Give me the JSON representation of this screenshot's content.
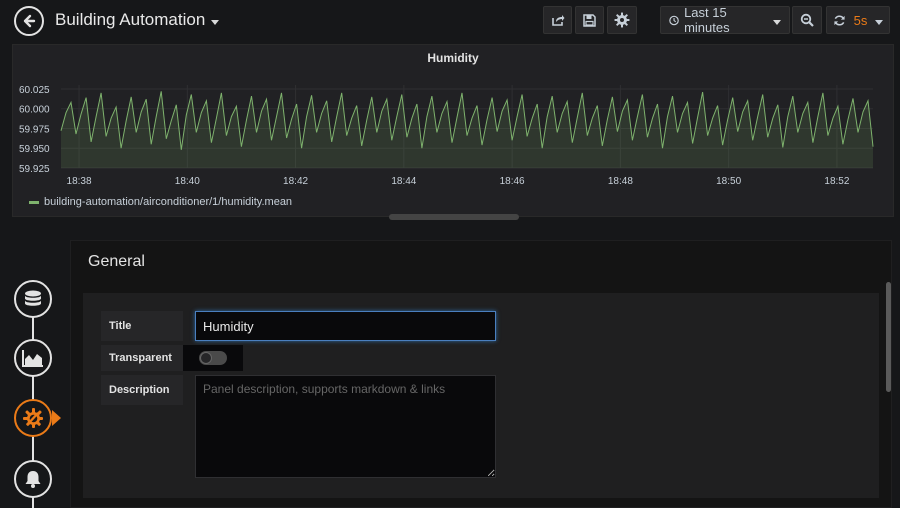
{
  "header": {
    "dashboard_title": "Building Automation",
    "time_range": "Last 15 minutes",
    "refresh_interval": "5s"
  },
  "panel": {
    "title": "Humidity"
  },
  "chart_data": {
    "type": "line",
    "title": "Humidity",
    "xlabel": "",
    "ylabel": "",
    "x_ticks": [
      "18:38",
      "18:40",
      "18:42",
      "18:44",
      "18:46",
      "18:48",
      "18:50",
      "18:52"
    ],
    "y_ticks": [
      "60.025",
      "60.000",
      "59.975",
      "59.950",
      "59.925"
    ],
    "ylim": [
      59.925,
      60.03
    ],
    "xlim": [
      "18:37:40",
      "18:52:40"
    ],
    "grid": true,
    "fill": true,
    "color": "#7eb26d",
    "legend_position": "bottom-left",
    "series": [
      {
        "name": "building-automation/airconditioner/1/humidity.mean",
        "values": [
          59.972,
          59.995,
          60.008,
          59.968,
          59.993,
          60.014,
          59.958,
          59.99,
          60.02,
          59.965,
          59.988,
          60.002,
          59.95,
          59.985,
          60.015,
          59.97,
          59.996,
          60.012,
          59.955,
          59.99,
          60.022,
          59.962,
          59.985,
          60.005,
          59.948,
          59.992,
          60.018,
          59.97,
          59.995,
          60.01,
          59.957,
          59.988,
          60.02,
          59.966,
          59.99,
          60.003,
          59.952,
          59.986,
          60.016,
          59.97,
          59.997,
          60.012,
          59.96,
          59.99,
          60.02,
          59.963,
          59.987,
          60.006,
          59.95,
          59.99,
          60.017,
          59.97,
          59.994,
          60.01,
          59.958,
          59.99,
          60.02,
          59.966,
          59.988,
          60.004,
          59.953,
          59.986,
          60.015,
          59.97,
          59.997,
          60.012,
          59.96,
          59.99,
          60.018,
          59.964,
          59.988,
          60.006,
          59.95,
          59.99,
          60.016,
          59.97,
          59.994,
          60.009,
          59.957,
          59.989,
          60.02,
          59.966,
          59.988,
          60.004,
          59.954,
          59.986,
          60.014,
          59.971,
          59.997,
          60.011,
          59.96,
          59.99,
          60.018,
          59.965,
          59.988,
          60.006,
          59.95,
          59.99,
          60.016,
          59.97,
          59.994,
          60.009,
          59.957,
          59.989,
          60.02,
          59.966,
          59.988,
          60.004,
          59.953,
          59.986,
          60.015,
          59.971,
          59.997,
          60.011,
          59.96,
          59.99,
          60.018,
          59.964,
          59.988,
          60.006,
          59.95,
          59.99,
          60.016,
          59.97,
          59.994,
          60.008,
          59.956,
          59.989,
          60.021,
          59.966,
          59.988,
          60.004,
          59.954,
          59.986,
          60.014,
          59.971,
          59.996,
          60.01,
          59.96,
          59.99,
          60.018,
          59.964,
          59.988,
          60.005,
          59.951,
          59.99,
          60.016,
          59.97,
          59.994,
          60.008,
          59.957,
          59.99,
          60.02,
          59.966,
          59.988,
          60.003,
          59.955,
          59.986,
          60.013,
          59.97,
          59.996,
          60.01,
          59.952
        ]
      }
    ]
  },
  "editor": {
    "section_title": "General",
    "title_label": "Title",
    "title_value": "Humidity",
    "transparent_label": "Transparent",
    "transparent_on": false,
    "description_label": "Description",
    "description_placeholder": "Panel description, supports markdown & links"
  },
  "icons": {
    "back": "arrow-left-icon",
    "share": "share-icon",
    "save": "save-icon",
    "settings": "gear-icon",
    "clock": "clock-icon",
    "zoom_out": "zoom-out-icon",
    "refresh": "refresh-icon",
    "rail": [
      "database-icon",
      "graph-icon",
      "wrench-gear-icon",
      "bell-icon"
    ]
  }
}
